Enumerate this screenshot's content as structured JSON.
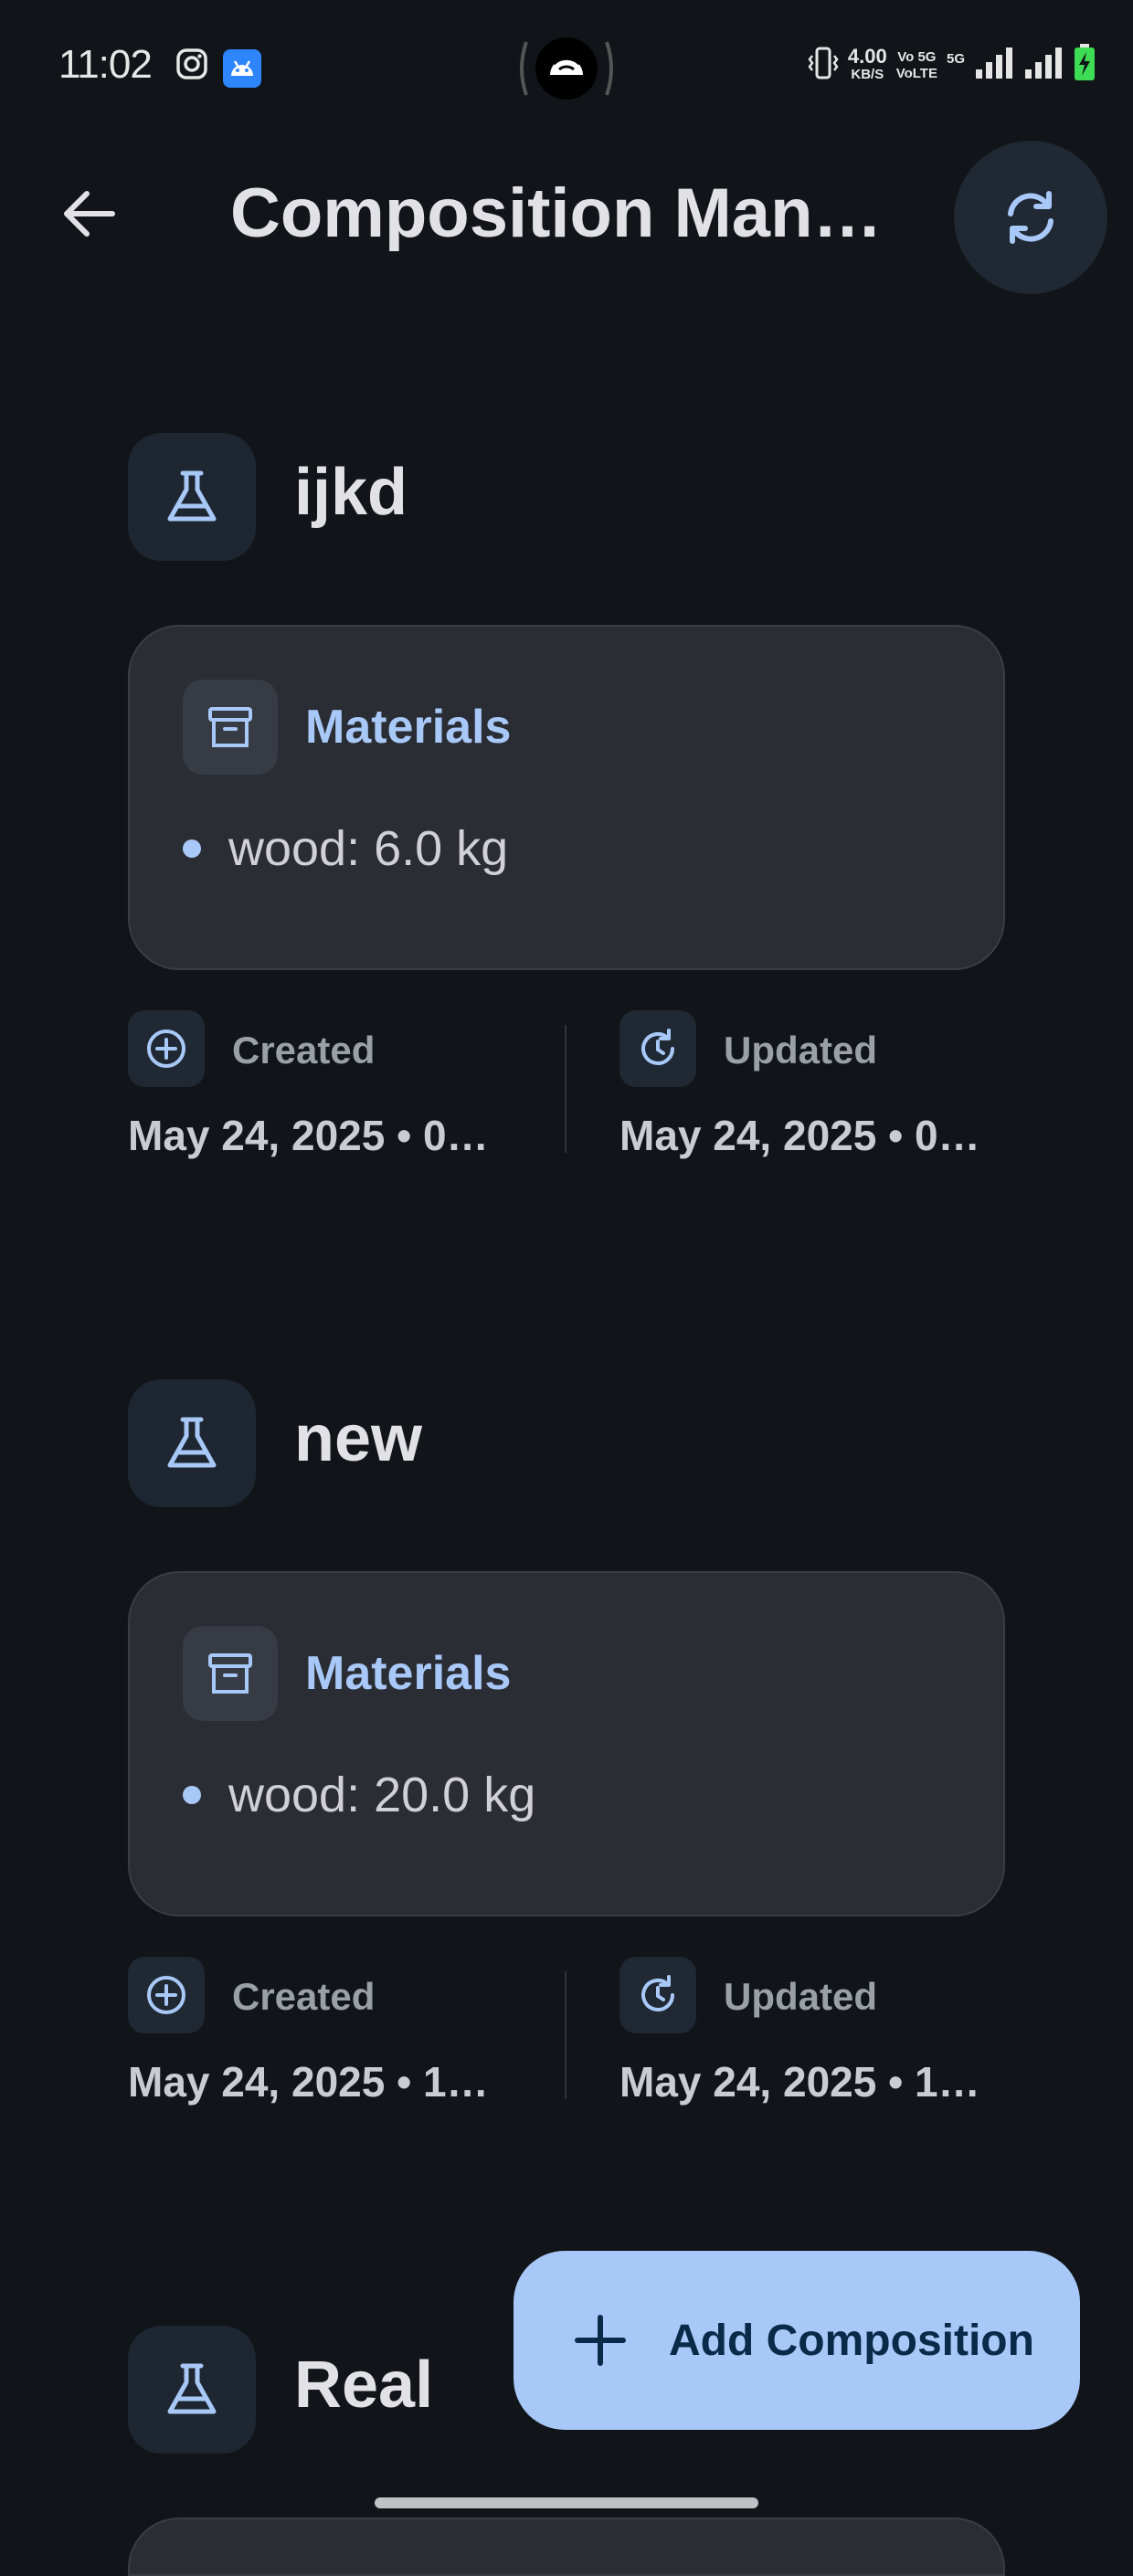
{
  "status_bar": {
    "time": "11:02",
    "net_speed_value": "4.00",
    "net_speed_unit": "KB/S",
    "volte_top": "Vo 5G",
    "volte_bottom": "VoLTE",
    "network_type": "5G",
    "icons": [
      "instagram-icon",
      "android-icon",
      "hotspot-icon",
      "vibrate-icon",
      "signal-icon",
      "signal-icon",
      "battery-charging-icon"
    ]
  },
  "app_bar": {
    "title": "Composition Man…",
    "back_icon": "arrow-left-icon",
    "refresh_icon": "refresh-icon"
  },
  "compositions": [
    {
      "name": "ijkd",
      "icon": "flask-icon",
      "materials_title": "Materials",
      "materials": [
        "wood: 6.0 kg"
      ],
      "created_label": "Created",
      "created_value": "May 24, 2025 • 0…",
      "updated_label": "Updated",
      "updated_value": "May 24, 2025 • 0…"
    },
    {
      "name": "new",
      "icon": "flask-icon",
      "materials_title": "Materials",
      "materials": [
        "wood: 20.0 kg"
      ],
      "created_label": "Created",
      "created_value": "May 24, 2025 • 1…",
      "updated_label": "Updated",
      "updated_value": "May 24, 2025 • 1…"
    },
    {
      "name": "Real",
      "icon": "flask-icon"
    }
  ],
  "fab": {
    "label": "Add Composition",
    "icon": "plus-icon"
  },
  "colors": {
    "background": "#111418",
    "accent": "#a8c8f8",
    "card": "#2a2d33",
    "fab_text": "#0b2a4a"
  }
}
